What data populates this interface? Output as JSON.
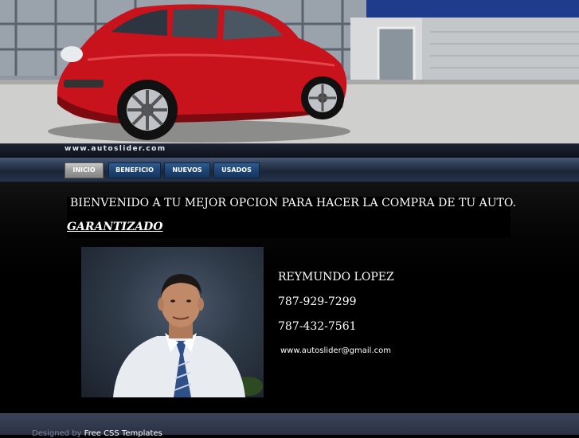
{
  "header": {
    "site_url": "www.autoslider.com"
  },
  "nav": {
    "tabs": [
      {
        "label": "INICIO",
        "active": true
      },
      {
        "label": "BENEFICIO",
        "active": false
      },
      {
        "label": "NUEVOS",
        "active": false
      },
      {
        "label": "USADOS",
        "active": false
      }
    ]
  },
  "main": {
    "welcome": "BIENVENIDO A TU MEJOR OPCION PARA HACER LA COMPRA DE TU AUTO.",
    "guarantee": "GARANTIZADO",
    "contact": {
      "name": "REYMUNDO LOPEZ",
      "phone1": "787-929-7299",
      "phone2": "787-432-7561",
      "email": "www.autoslider@gmail.com"
    }
  },
  "footer": {
    "prefix": "Designed by",
    "link": "Free CSS Templates"
  },
  "colors": {
    "nav_tab": "#1e4575",
    "nav_tab_active": "#9d9d9d",
    "car_red": "#c8121c",
    "background": "#000000"
  }
}
